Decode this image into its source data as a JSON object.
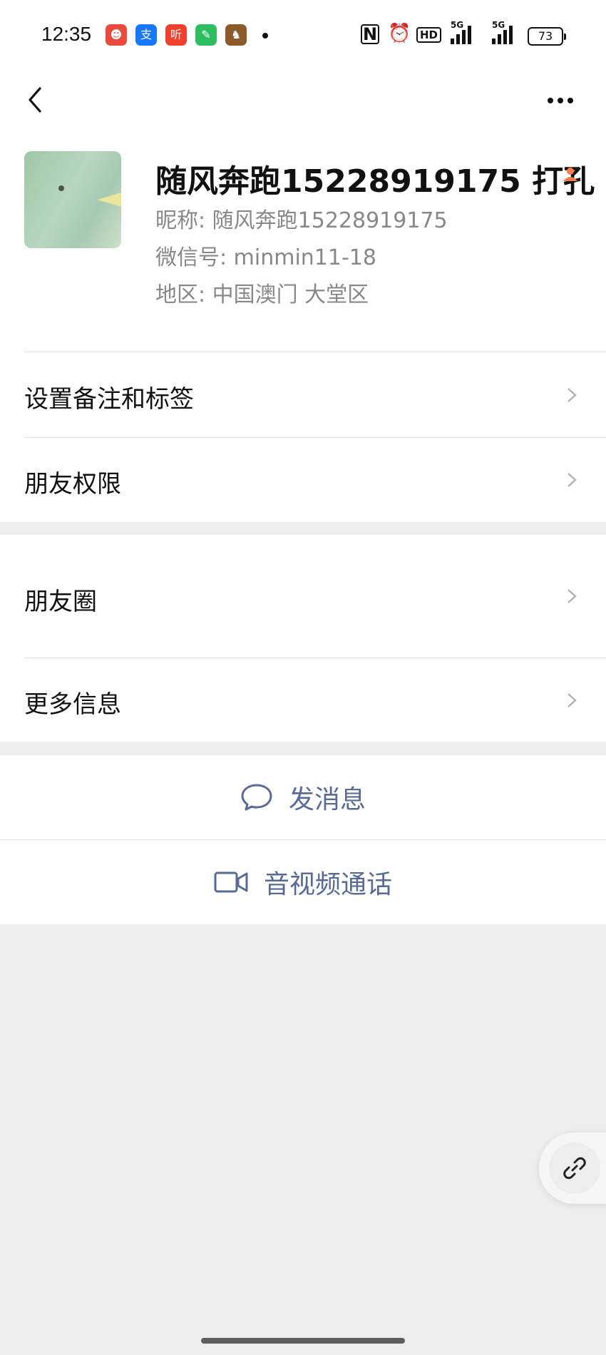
{
  "status_bar": {
    "time": "12:35",
    "app_icons": [
      {
        "name": "weibo-app-icon",
        "glyph": "☻",
        "color": "#e84a3c"
      },
      {
        "name": "alipay-app-icon",
        "glyph": "支",
        "color": "#1677ff"
      },
      {
        "name": "ting-app-icon",
        "glyph": "听",
        "color": "#f0412e"
      },
      {
        "name": "evernote-app-icon",
        "glyph": "✎",
        "color": "#2dbe60"
      },
      {
        "name": "game-app-icon",
        "glyph": "♞",
        "color": "#8a5a2b"
      }
    ],
    "nfc": "N",
    "hd": "HD",
    "signal_tag": "5G",
    "battery": "73"
  },
  "profile": {
    "display_name": "随风奔跑15228919175 打孔",
    "nickname": "昵称:  随风奔跑15228919175",
    "wechat_id": "微信号:  minmin11-18",
    "region": "地区:  中国澳门  大堂区"
  },
  "menu": {
    "set_remark_label": "设置备注和标签",
    "friend_permissions_label": "朋友权限",
    "moments_label": "朋友圈",
    "more_info_label": "更多信息"
  },
  "actions": {
    "send_message_label": "发消息",
    "av_call_label": "音视频通话"
  },
  "colors": {
    "link_blue": "#576b95",
    "badge_orange": "#fa7b4f"
  }
}
